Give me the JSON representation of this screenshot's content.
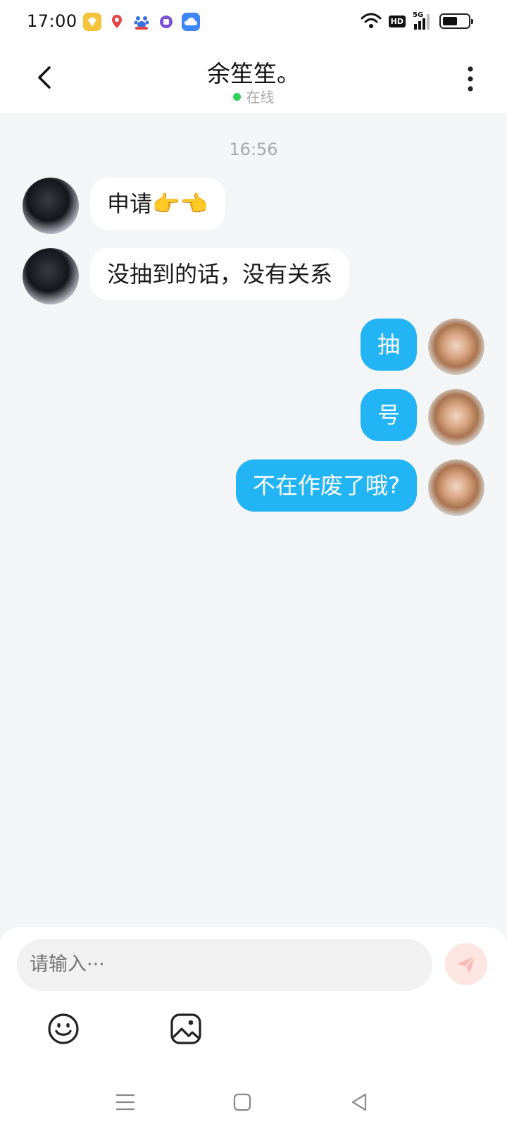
{
  "status_bar": {
    "time": "17:00",
    "notification_icons": [
      "tasks-app-icon",
      "location-pin-icon",
      "baidu-paw-icon",
      "chat-app-icon",
      "cloud-app-icon"
    ],
    "network_label": "5G",
    "hd_label": "HD",
    "battery_level": 0.55
  },
  "header": {
    "title": "余笙笙。",
    "presence": "在线",
    "presence_color": "#2fcf58"
  },
  "chat": {
    "timestamp": "16:56",
    "messages": [
      {
        "side": "in",
        "text": "申请👉👈"
      },
      {
        "side": "in",
        "text": "没抽到的话，没有关系"
      },
      {
        "side": "out",
        "text": "抽"
      },
      {
        "side": "out",
        "text": "号"
      },
      {
        "side": "out",
        "text": "不在作废了哦?"
      }
    ],
    "bubble_out_color": "#22b4f5",
    "bubble_in_color": "#ffffff"
  },
  "input": {
    "placeholder": "请输入···"
  },
  "toolbar": {
    "icons": [
      "emoji-icon",
      "image-icon"
    ]
  },
  "nav": {
    "icons": [
      "menu-icon",
      "home-icon",
      "back-triangle-icon"
    ]
  }
}
